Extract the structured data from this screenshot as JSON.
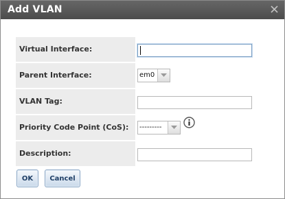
{
  "dialog": {
    "title": "Add VLAN"
  },
  "form": {
    "virtual_interface": {
      "label": "Virtual Interface:",
      "value": ""
    },
    "parent_interface": {
      "label": "Parent Interface:",
      "selected": "em0"
    },
    "vlan_tag": {
      "label": "VLAN Tag:",
      "value": ""
    },
    "priority_code_point": {
      "label": "Priority Code Point (CoS):",
      "selected": "---------"
    },
    "description": {
      "label": "Description:",
      "value": ""
    }
  },
  "buttons": {
    "ok_label": "OK",
    "cancel_label": "Cancel"
  },
  "icons": {
    "close": "close-icon",
    "dropdown": "chevron-down-icon",
    "info": "info-icon"
  },
  "colors": {
    "titlebar": "#575757",
    "label_bg": "#ececec",
    "button_text": "#1f3f66",
    "button_border": "#8aa7c6"
  }
}
